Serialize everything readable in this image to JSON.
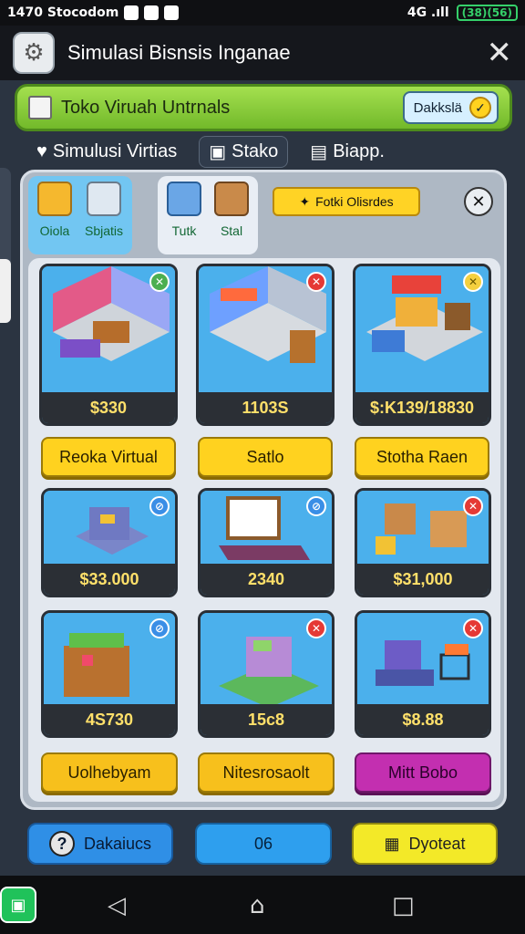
{
  "status_bar": {
    "time_text": "1470 Stocodom",
    "signal_text": "4G .ıll",
    "battery_text": "(38)(56)"
  },
  "app_bar": {
    "title": "Simulasi Bisnsis Inganae",
    "icon": "gear-icon",
    "close_label": "✕"
  },
  "banner": {
    "text": "Toko Viruah Untrnals",
    "button_label": "Dakkslä",
    "coin_icon": "coin-icon"
  },
  "nav_tabs": [
    {
      "label": "Simulusi Virtias",
      "icon": "heart-pin-icon"
    },
    {
      "label": "Stako",
      "icon": "shop-icon"
    },
    {
      "label": "Biapp.",
      "icon": "chat-icon"
    }
  ],
  "categories": {
    "group1": [
      {
        "label": "Oiola",
        "icon": "box-icon"
      },
      {
        "label": "Sbjatis",
        "icon": "tools-icon"
      }
    ],
    "group2": [
      {
        "label": "Tutk",
        "icon": "cube-icon"
      },
      {
        "label": "Stal",
        "icon": "crate-icon"
      }
    ],
    "featured_label": "Fotki Olisrdes"
  },
  "stores_top": [
    {
      "price": "$330",
      "badge": "✕",
      "badge_color": "green"
    },
    {
      "price": "1103S",
      "badge": "✕",
      "badge_color": "red"
    },
    {
      "price": "$:K139/18830",
      "badge": "✕",
      "badge_color": "yellow"
    }
  ],
  "buttons_row1": [
    "Reoka Virtual",
    "Satlo",
    "Stotha Raen"
  ],
  "items_mid": [
    {
      "price": "$33.000",
      "badge": "⊘",
      "badge_color": "blue"
    },
    {
      "price": "2340",
      "badge": "⊘",
      "badge_color": "blue"
    },
    {
      "price": "$31,000",
      "badge": "✕",
      "badge_color": "red"
    }
  ],
  "items_bottom": [
    {
      "price": "4S730",
      "badge": "⊘",
      "badge_color": "blue"
    },
    {
      "price": "15c8",
      "badge": "✕",
      "badge_color": "red"
    },
    {
      "price": "$8.88",
      "badge": "✕",
      "badge_color": "red"
    }
  ],
  "buttons_row2": [
    "Uolhebyam",
    "Nitesrosaolt",
    "Mitt Bobo"
  ],
  "actions": {
    "left_label": "Dakaiucs",
    "center_label": "06",
    "right_label": "Dyoteat"
  },
  "colors": {
    "accent_green": "#7cc13a",
    "price_text": "#ffe06a",
    "button_yellow": "#ffd21f",
    "button_purple": "#c32fb0"
  }
}
